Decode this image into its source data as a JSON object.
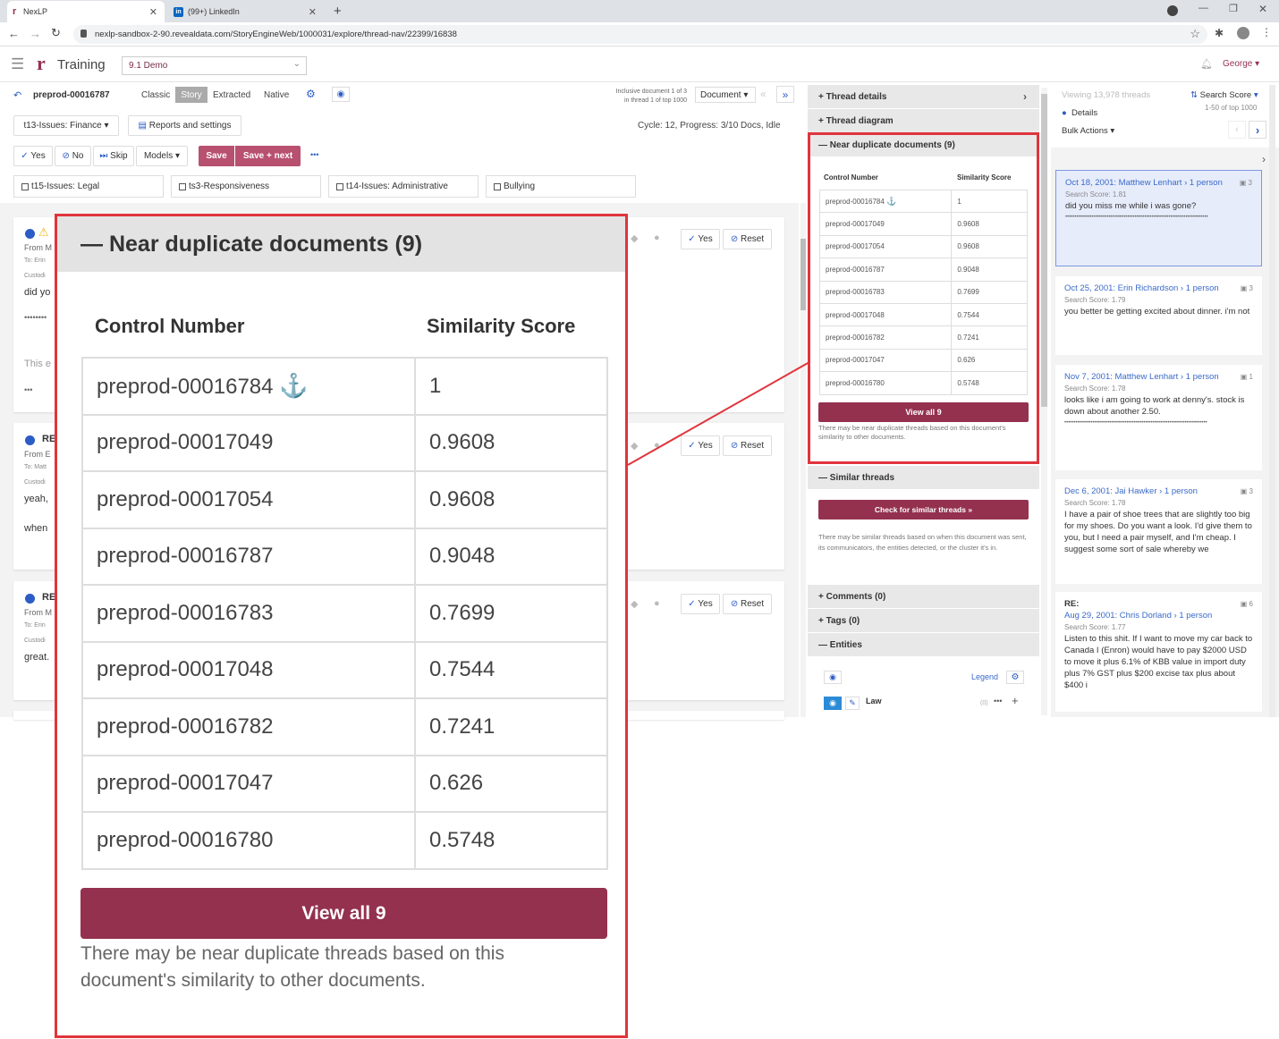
{
  "browser": {
    "tabs": [
      {
        "label": "NexLP"
      },
      {
        "label": "(99+) LinkedIn"
      }
    ],
    "url": "nexlp-sandbox-2-90.revealdata.com/StoryEngineWeb/1000031/explore/thread-nav/22399/16838"
  },
  "app": {
    "title": "Training",
    "project": "9.1 Demo",
    "user": "George"
  },
  "toolbar": {
    "doc_id": "preprod-00016787",
    "views": [
      "Classic",
      "Story",
      "Extracted",
      "Native"
    ],
    "active_view": "Story",
    "inclusive_line1": "Inclusive document 1 of 3",
    "inclusive_line2": "in thread 1 of top 1000",
    "document_select": "Document",
    "issue_select": "t13-Issues: Finance",
    "reports_label": "Reports and settings",
    "cycle_status": "Cycle: 12, Progress: 3/10 Docs, Idle",
    "yes": "Yes",
    "no": "No",
    "skip": "Skip",
    "models": "Models",
    "save": "Save",
    "save_next": "Save + next",
    "more": "•••"
  },
  "tags": [
    "t15-Issues: Legal",
    "ts3-Responsiveness",
    "t14-Issues: Administrative",
    "Bullying"
  ],
  "docs": [
    {
      "lines": [
        "From M",
        "To: Erin",
        "Custodi",
        "did yo",
        "••••••••",
        "This e",
        "•••"
      ]
    },
    {
      "title": "RE",
      "lines": [
        "From E",
        "To: Matt",
        "Custodi",
        "yeah,",
        "when"
      ]
    },
    {
      "title": "RE",
      "lines": [
        "From M",
        "To: Erin",
        "Custodi",
        "great."
      ]
    }
  ],
  "doc_actions": {
    "yes": "Yes",
    "reset": "Reset"
  },
  "mid": {
    "thread_details": "Thread details",
    "thread_diagram": "Thread diagram",
    "near_dup_title": "Near duplicate documents (9)",
    "col_control": "Control Number",
    "col_similarity": "Similarity Score",
    "rows": [
      {
        "control": "preprod-00016784",
        "score": "1",
        "anchor": true
      },
      {
        "control": "preprod-00017049",
        "score": "0.9608"
      },
      {
        "control": "preprod-00017054",
        "score": "0.9608"
      },
      {
        "control": "preprod-00016787",
        "score": "0.9048"
      },
      {
        "control": "preprod-00016783",
        "score": "0.7699"
      },
      {
        "control": "preprod-00017048",
        "score": "0.7544"
      },
      {
        "control": "preprod-00016782",
        "score": "0.7241"
      },
      {
        "control": "preprod-00017047",
        "score": "0.626"
      },
      {
        "control": "preprod-00016780",
        "score": "0.5748"
      }
    ],
    "view_all": "View all 9",
    "near_dup_note": "There may be near duplicate threads based on this document's similarity to other documents.",
    "similar_threads": "Similar threads",
    "check_similar": "Check for similar threads »",
    "similar_note": "There may be similar threads based on when this document was sent, its communicators, the entities detected, or the cluster it's in.",
    "comments": "Comments (0)",
    "tags": "Tags (0)",
    "entities": "Entities",
    "legend": "Legend",
    "entity_law": "Law",
    "entity_count": "(0)"
  },
  "right": {
    "viewing": "Viewing 13,978 threads",
    "sort": "Search Score",
    "range": "1-50 of top 1000",
    "details": "Details",
    "bulk": "Bulk Actions",
    "threads": [
      {
        "head": "Oct 18, 2001: Matthew Lenhart › 1 person",
        "count": "3",
        "score": "Search Score: 1.81",
        "body": "did you miss me while i was gone?",
        "dots": "••••••••••••••••••••••••••••••••••••••••••••••••••••••••••••••••••••••••••••"
      },
      {
        "head": "Oct 25, 2001: Erin Richardson › 1 person",
        "count": "3",
        "score": "Search Score: 1.79",
        "body": "you better be getting excited about dinner. i'm not"
      },
      {
        "head": "Nov 7, 2001: Matthew Lenhart › 1 person",
        "count": "1",
        "score": "Search Score: 1.78",
        "body": "looks like i am going to work at denny's. stock is down about another 2.50.",
        "dots": "••••••••••••••••••••••••••••••••••••••••••••••••••••••••••••••••••••••••••••"
      },
      {
        "head": "Dec 6, 2001: Jai Hawker › 1 person",
        "count": "3",
        "score": "Search Score: 1.78",
        "body": "I have a pair of shoe trees that are slightly too big for my shoes. Do you want a look. I'd give them to you, but I need a pair myself, and I'm cheap. I suggest some sort of sale whereby we"
      },
      {
        "title": "RE:",
        "head": "Aug 29, 2001: Chris Dorland › 1 person",
        "count": "6",
        "score": "Search Score: 1.77",
        "body": "Listen to this shit. If I want to move my car back to Canada I (Enron) would have to pay $2000 USD to move it plus 6.1% of KBB value in import duty plus 7% GST plus $200 excise tax plus about $400 i"
      }
    ]
  },
  "colors": {
    "accent": "#94314f",
    "link": "#3a6ac8",
    "highlight": "#e0343c",
    "dot": "#2c5cc5"
  }
}
